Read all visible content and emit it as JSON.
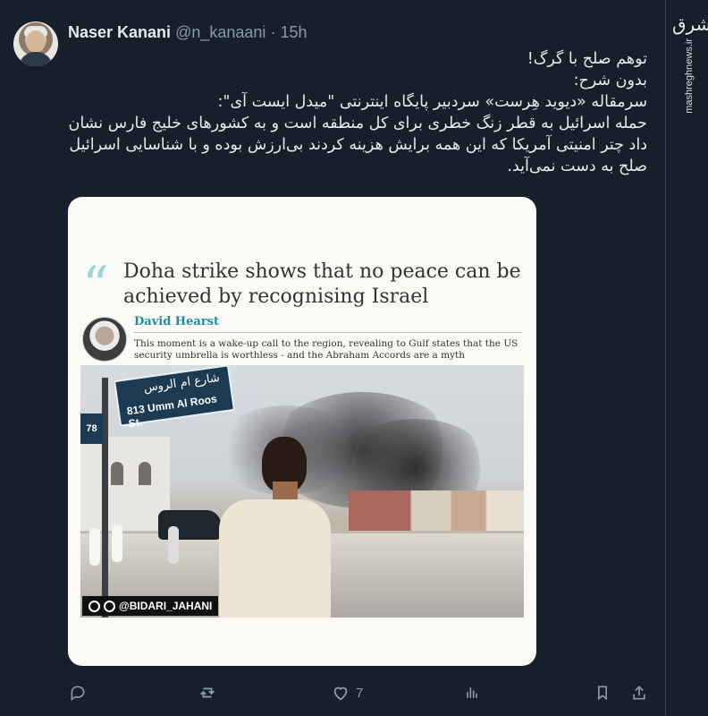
{
  "tweet": {
    "author_name": "Naser Kanani",
    "handle": "@n_kanaani",
    "separator": "·",
    "time": "15h",
    "body_lines": [
      "توهم صلح با گرگ!",
      "بدون شرح:",
      "سرمقاله «دیوید هِرست» سردبیر پایگاه اینترنتی \"میدل ایست آی\":",
      "حمله اسرائیل به قطر زنگ خطری برای کل منطقه است و به کشورهای خلیج فارس نشان داد چتر امنیتی آمریکا که این همه برایش هزینه کردند بی‌ارزش بوده و با شناسایی اسرائیل صلح به دست نمی‌آید."
    ],
    "media": {
      "headline": "Doha strike shows that no peace can be achieved by recognising Israel",
      "author": "David Hearst",
      "summary": "This moment is a wake-up call to the region, revealing to Gulf states that the US security umbrella is worthless - and the Abraham Accords are a myth",
      "sign_arabic": "شارع ام الروس",
      "sign_number": "813",
      "sign_english": "Umm Al Roos St.",
      "sign_side_number": "78",
      "watermark": "@BIDARI_JAHANI"
    },
    "actions": [
      {
        "name": "reply",
        "icon": "reply-icon",
        "count": ""
      },
      {
        "name": "retweet",
        "icon": "retweet-icon",
        "count": ""
      },
      {
        "name": "like",
        "icon": "heart-icon",
        "count": "7"
      },
      {
        "name": "views",
        "icon": "analytics-icon",
        "count": ""
      },
      {
        "name": "bookmark",
        "icon": "bookmark-icon",
        "count": ""
      },
      {
        "name": "share",
        "icon": "share-icon",
        "count": ""
      }
    ]
  },
  "brand": {
    "logo": "مشرق",
    "url": "mashreghnews.ir"
  },
  "colors": {
    "background": "#15202b",
    "text": "#e7e9ea",
    "muted": "#8b98a5",
    "accent": "#1f8ca0"
  }
}
